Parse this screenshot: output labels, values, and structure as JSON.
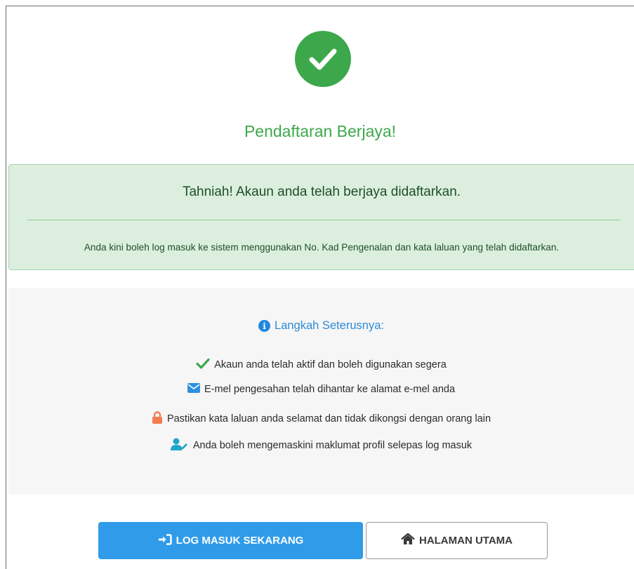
{
  "page": {
    "title": "Pendaftaran Berjaya!",
    "icon": "check-circle-icon"
  },
  "alert": {
    "heading": "Tahniah! Akaun anda telah berjaya didaftarkan.",
    "body": "Anda kini boleh log masuk ke sistem menggunakan No. Kad Pengenalan dan kata laluan yang telah didaftarkan."
  },
  "next_steps": {
    "heading": "Langkah Seterusnya:",
    "heading_icon": "info-icon",
    "items": [
      {
        "icon": "check-icon",
        "text": "Akaun anda telah aktif dan boleh digunakan segera"
      },
      {
        "icon": "envelope-icon",
        "text": "E-mel pengesahan telah dihantar ke alamat e-mel anda"
      },
      {
        "icon": "lock-icon",
        "text": "Pastikan kata laluan anda selamat dan tidak dikongsi dengan orang lain"
      },
      {
        "icon": "user-edit-icon",
        "text": "Anda boleh mengemaskini maklumat profil selepas log masuk"
      }
    ]
  },
  "buttons": {
    "login": {
      "label": "LOG MASUK SEKARANG",
      "icon": "sign-in-icon"
    },
    "home": {
      "label": "HALAMAN UTAMA",
      "icon": "home-icon"
    }
  },
  "colors": {
    "success": "#3da84b",
    "alert_bg": "#dcefdf",
    "info": "#2e8bd8",
    "primary": "#2f9be9",
    "lock": "#f27d4f"
  }
}
